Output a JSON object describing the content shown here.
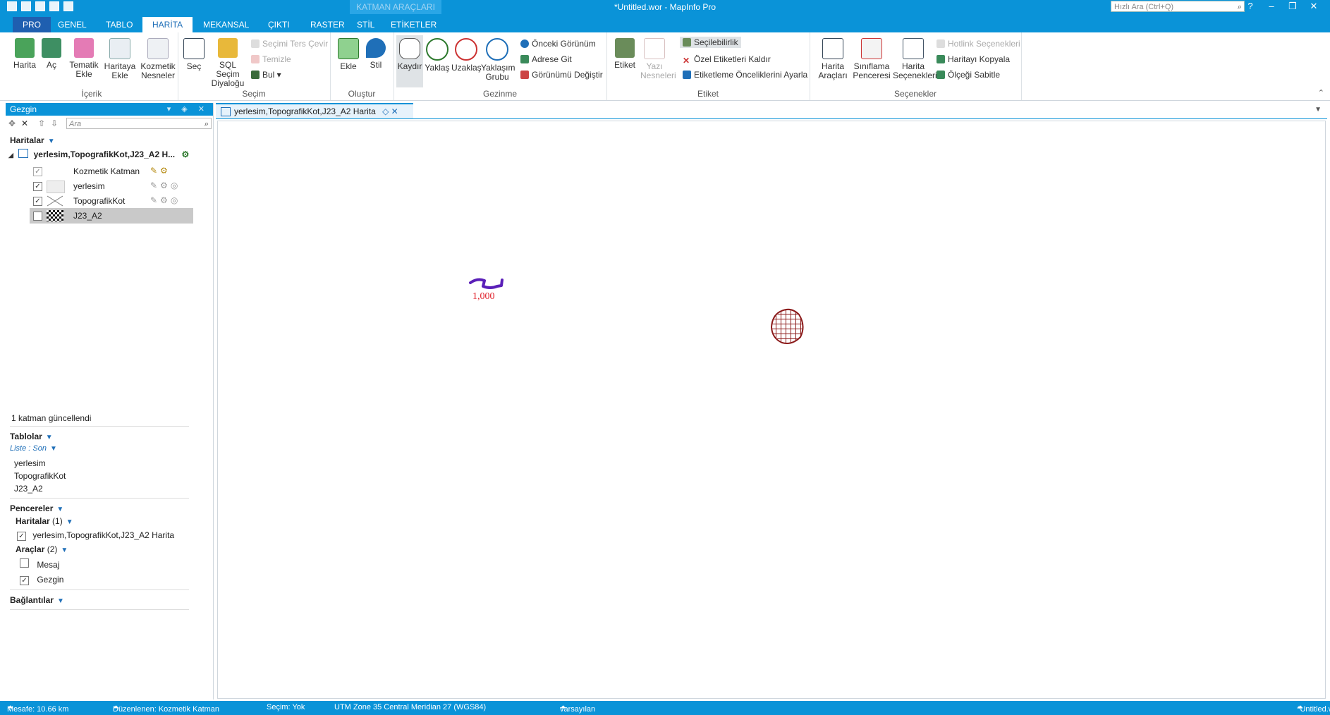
{
  "window": {
    "title": "*Untitled.wor - MapInfo Pro",
    "context_tab_label": "KATMAN ARAÇLARI",
    "search_placeholder": "Hızlı Ara (Ctrl+Q)",
    "controls": [
      "?",
      "–",
      "❐",
      "✕"
    ]
  },
  "tabs": [
    "PRO",
    "GENEL",
    "TABLO",
    "HARİTA",
    "MEKANSAL",
    "ÇIKTI",
    "RASTER",
    "STİL",
    "ETİKETLER"
  ],
  "ribbon": {
    "icerik": {
      "label": "İçerik",
      "buttons": [
        "Harita",
        "Aç",
        "Tematik Ekle",
        "Haritaya Ekle",
        "Kozmetik Nesneler"
      ]
    },
    "secim": {
      "label": "Seçim",
      "buttons": [
        "Seç",
        "SQL Seçim Diyaloğu"
      ],
      "small": [
        "Seçimi Ters Çevir",
        "Temizle",
        "Bul"
      ]
    },
    "olustur": {
      "label": "Oluştur",
      "buttons": [
        "Ekle",
        "Stil"
      ]
    },
    "gezinme": {
      "label": "Gezinme",
      "buttons": [
        "Kaydır",
        "Yaklaş",
        "Uzaklaş",
        "Yaklaşım Grubu"
      ],
      "small": [
        "Önceki Görünüm",
        "Adrese Git",
        "Görünümü Değiştir"
      ]
    },
    "etiket": {
      "label": "Etiket",
      "buttons": [
        "Etiket",
        "Yazı Nesneleri"
      ],
      "small": [
        "Seçilebilirlik",
        "Özel Etiketleri Kaldır",
        "Etiketleme Önceliklerini Ayarla"
      ]
    },
    "secenekler": {
      "label": "Seçenekler",
      "buttons": [
        "Harita Araçları",
        "Sınıflama Penceresi",
        "Harita Seçenekleri"
      ],
      "small": [
        "Hotlink Seçenekleri",
        "Haritayı Kopyala",
        "Ölçeği Sabitle"
      ]
    }
  },
  "explorer": {
    "title": "Gezgin",
    "search_placeholder": "Ara",
    "maps_header": "Haritalar",
    "map_name": "yerlesim,TopografikKot,J23_A2 H...",
    "layers": [
      {
        "name": "Kozmetik Katman",
        "checked": true
      },
      {
        "name": "yerlesim",
        "checked": true
      },
      {
        "name": "TopografikKot",
        "checked": true
      },
      {
        "name": "J23_A2",
        "checked": false
      }
    ],
    "status_message": "1 katman güncellendi",
    "tables_header": "Tablolar",
    "tables_list_label": "Liste : Son",
    "tables": [
      "yerlesim",
      "TopografikKot",
      "J23_A2"
    ],
    "windows_header": "Pencereler",
    "windows_maps_label": "Haritalar",
    "windows_maps_count": "(1)",
    "windows_map_item": "yerlesim,TopografikKot,J23_A2 Harita",
    "tools_label": "Araçlar",
    "tools_count": "(2)",
    "tools": [
      {
        "name": "Mesaj",
        "checked": false
      },
      {
        "name": "Gezgin",
        "checked": true
      }
    ],
    "connections_header": "Bağlantılar"
  },
  "document": {
    "tab_title": "yerlesim,TopografikKot,J23_A2 Harita",
    "tab_modifiers": "◇ ✕",
    "contour_label": "1,000"
  },
  "status": {
    "distance": "Mesafe: 10.66 km",
    "editing": "Düzenlenen: Kozmetik Katman",
    "selection": "Seçim: Yok",
    "projection": "UTM Zone 35 Central Meridian 27 (WGS84)",
    "style": "varsayılan",
    "workspace": "*Untitled.wor"
  },
  "colors": {
    "accent": "#0a93d8",
    "contour_line": "#5a1fb8",
    "contour_label": "#e0202a",
    "settlement_hatch": "#8b1a1a"
  }
}
